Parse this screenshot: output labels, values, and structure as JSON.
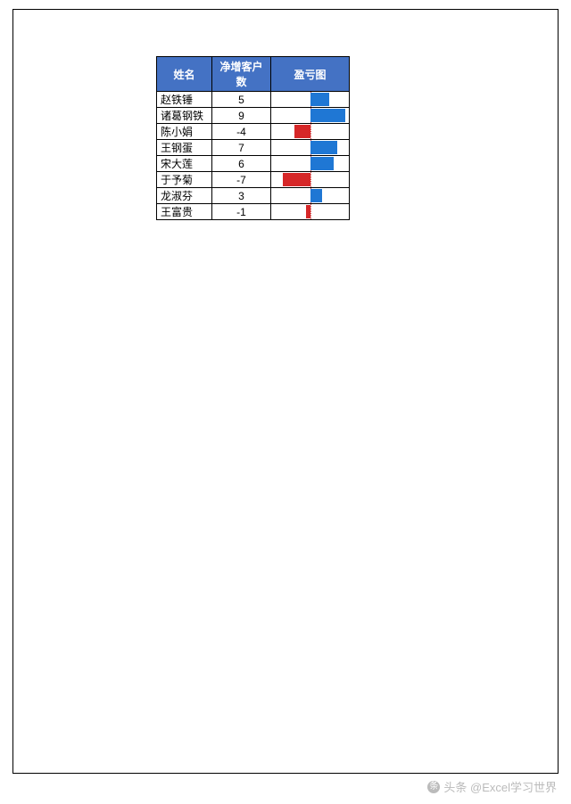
{
  "table": {
    "headers": {
      "name": "姓名",
      "value": "净增客户数",
      "chart": "盈亏图"
    },
    "rows": [
      {
        "name": "赵铁锤",
        "value": 5
      },
      {
        "name": "诸葛钢铁",
        "value": 9
      },
      {
        "name": "陈小娟",
        "value": -4
      },
      {
        "name": "王钢蛋",
        "value": 7
      },
      {
        "name": "宋大莲",
        "value": 6
      },
      {
        "name": "于予菊",
        "value": -7
      },
      {
        "name": "龙淑芬",
        "value": 3
      },
      {
        "name": "王富贵",
        "value": -1
      }
    ]
  },
  "footer": {
    "attribution": "头条 @Excel学习世界"
  },
  "chart_data": {
    "type": "bar",
    "title": "盈亏图",
    "xlabel": "净增客户数",
    "ylabel": "姓名",
    "categories": [
      "赵铁锤",
      "诸葛钢铁",
      "陈小娟",
      "王钢蛋",
      "宋大莲",
      "于予菊",
      "龙淑芬",
      "王富贵"
    ],
    "values": [
      5,
      9,
      -4,
      7,
      6,
      -7,
      3,
      -1
    ],
    "xlim": [
      -9,
      9
    ],
    "colors": {
      "positive": "#1F77D4",
      "negative": "#D62728"
    }
  }
}
